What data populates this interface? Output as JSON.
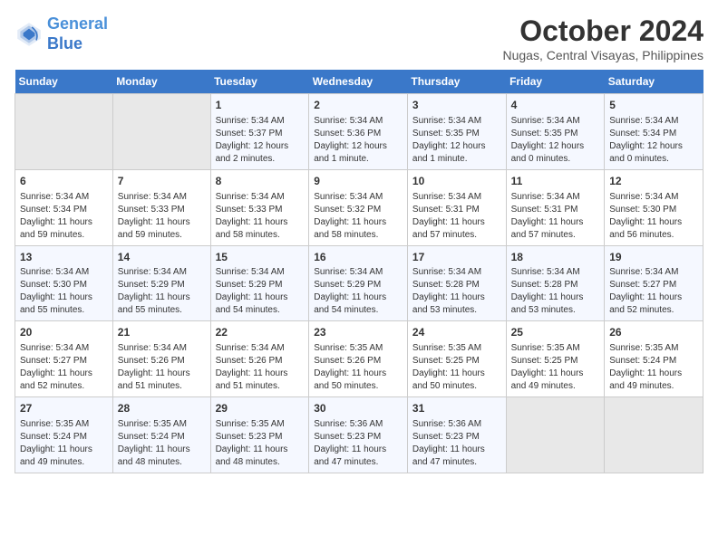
{
  "header": {
    "logo_line1": "General",
    "logo_line2": "Blue",
    "month": "October 2024",
    "location": "Nugas, Central Visayas, Philippines"
  },
  "weekdays": [
    "Sunday",
    "Monday",
    "Tuesday",
    "Wednesday",
    "Thursday",
    "Friday",
    "Saturday"
  ],
  "weeks": [
    [
      {
        "day": "",
        "info": ""
      },
      {
        "day": "",
        "info": ""
      },
      {
        "day": "1",
        "info": "Sunrise: 5:34 AM\nSunset: 5:37 PM\nDaylight: 12 hours\nand 2 minutes."
      },
      {
        "day": "2",
        "info": "Sunrise: 5:34 AM\nSunset: 5:36 PM\nDaylight: 12 hours\nand 1 minute."
      },
      {
        "day": "3",
        "info": "Sunrise: 5:34 AM\nSunset: 5:35 PM\nDaylight: 12 hours\nand 1 minute."
      },
      {
        "day": "4",
        "info": "Sunrise: 5:34 AM\nSunset: 5:35 PM\nDaylight: 12 hours\nand 0 minutes."
      },
      {
        "day": "5",
        "info": "Sunrise: 5:34 AM\nSunset: 5:34 PM\nDaylight: 12 hours\nand 0 minutes."
      }
    ],
    [
      {
        "day": "6",
        "info": "Sunrise: 5:34 AM\nSunset: 5:34 PM\nDaylight: 11 hours\nand 59 minutes."
      },
      {
        "day": "7",
        "info": "Sunrise: 5:34 AM\nSunset: 5:33 PM\nDaylight: 11 hours\nand 59 minutes."
      },
      {
        "day": "8",
        "info": "Sunrise: 5:34 AM\nSunset: 5:33 PM\nDaylight: 11 hours\nand 58 minutes."
      },
      {
        "day": "9",
        "info": "Sunrise: 5:34 AM\nSunset: 5:32 PM\nDaylight: 11 hours\nand 58 minutes."
      },
      {
        "day": "10",
        "info": "Sunrise: 5:34 AM\nSunset: 5:31 PM\nDaylight: 11 hours\nand 57 minutes."
      },
      {
        "day": "11",
        "info": "Sunrise: 5:34 AM\nSunset: 5:31 PM\nDaylight: 11 hours\nand 57 minutes."
      },
      {
        "day": "12",
        "info": "Sunrise: 5:34 AM\nSunset: 5:30 PM\nDaylight: 11 hours\nand 56 minutes."
      }
    ],
    [
      {
        "day": "13",
        "info": "Sunrise: 5:34 AM\nSunset: 5:30 PM\nDaylight: 11 hours\nand 55 minutes."
      },
      {
        "day": "14",
        "info": "Sunrise: 5:34 AM\nSunset: 5:29 PM\nDaylight: 11 hours\nand 55 minutes."
      },
      {
        "day": "15",
        "info": "Sunrise: 5:34 AM\nSunset: 5:29 PM\nDaylight: 11 hours\nand 54 minutes."
      },
      {
        "day": "16",
        "info": "Sunrise: 5:34 AM\nSunset: 5:29 PM\nDaylight: 11 hours\nand 54 minutes."
      },
      {
        "day": "17",
        "info": "Sunrise: 5:34 AM\nSunset: 5:28 PM\nDaylight: 11 hours\nand 53 minutes."
      },
      {
        "day": "18",
        "info": "Sunrise: 5:34 AM\nSunset: 5:28 PM\nDaylight: 11 hours\nand 53 minutes."
      },
      {
        "day": "19",
        "info": "Sunrise: 5:34 AM\nSunset: 5:27 PM\nDaylight: 11 hours\nand 52 minutes."
      }
    ],
    [
      {
        "day": "20",
        "info": "Sunrise: 5:34 AM\nSunset: 5:27 PM\nDaylight: 11 hours\nand 52 minutes."
      },
      {
        "day": "21",
        "info": "Sunrise: 5:34 AM\nSunset: 5:26 PM\nDaylight: 11 hours\nand 51 minutes."
      },
      {
        "day": "22",
        "info": "Sunrise: 5:34 AM\nSunset: 5:26 PM\nDaylight: 11 hours\nand 51 minutes."
      },
      {
        "day": "23",
        "info": "Sunrise: 5:35 AM\nSunset: 5:26 PM\nDaylight: 11 hours\nand 50 minutes."
      },
      {
        "day": "24",
        "info": "Sunrise: 5:35 AM\nSunset: 5:25 PM\nDaylight: 11 hours\nand 50 minutes."
      },
      {
        "day": "25",
        "info": "Sunrise: 5:35 AM\nSunset: 5:25 PM\nDaylight: 11 hours\nand 49 minutes."
      },
      {
        "day": "26",
        "info": "Sunrise: 5:35 AM\nSunset: 5:24 PM\nDaylight: 11 hours\nand 49 minutes."
      }
    ],
    [
      {
        "day": "27",
        "info": "Sunrise: 5:35 AM\nSunset: 5:24 PM\nDaylight: 11 hours\nand 49 minutes."
      },
      {
        "day": "28",
        "info": "Sunrise: 5:35 AM\nSunset: 5:24 PM\nDaylight: 11 hours\nand 48 minutes."
      },
      {
        "day": "29",
        "info": "Sunrise: 5:35 AM\nSunset: 5:23 PM\nDaylight: 11 hours\nand 48 minutes."
      },
      {
        "day": "30",
        "info": "Sunrise: 5:36 AM\nSunset: 5:23 PM\nDaylight: 11 hours\nand 47 minutes."
      },
      {
        "day": "31",
        "info": "Sunrise: 5:36 AM\nSunset: 5:23 PM\nDaylight: 11 hours\nand 47 minutes."
      },
      {
        "day": "",
        "info": ""
      },
      {
        "day": "",
        "info": ""
      }
    ]
  ]
}
